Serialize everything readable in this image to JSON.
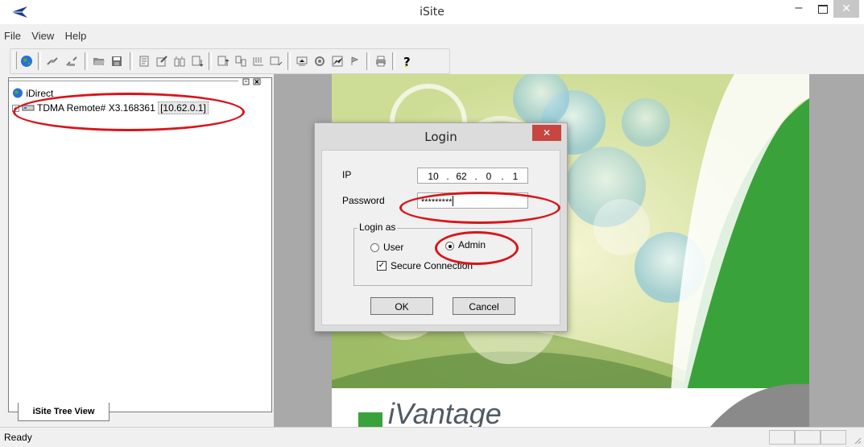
{
  "window": {
    "title": "iSite",
    "controls": {
      "minimize": "–",
      "close": "✕"
    },
    "accent_red": "#d7151b",
    "close_button_color": "#c7463f"
  },
  "menu": {
    "items": [
      "File",
      "View",
      "Help"
    ]
  },
  "toolbar": {
    "icons": [
      "globe-icon",
      "connect-icon",
      "disconnect-icon",
      "open-folder-icon",
      "save-icon",
      "config-icon",
      "edit-icon",
      "compare-icon",
      "download-icon",
      "upload-icon",
      "network-icon",
      "reset-icon",
      "telnet-icon",
      "monitor-icon",
      "print-icon",
      "help-icon"
    ]
  },
  "tree": {
    "root_label": "iDirect",
    "node": {
      "expander": "+",
      "label": "TDMA Remote# X3.168361",
      "ip": "[10.62.0.1]"
    },
    "tab_label": "iSite Tree View"
  },
  "splash": {
    "brand": "iVantage",
    "brand_green": "#3aa23b"
  },
  "dialog": {
    "title": "Login",
    "ip_label": "IP",
    "ip_octets": [
      "10",
      "62",
      "0",
      "1"
    ],
    "password_label": "Password",
    "password_value": "*********",
    "group_label": "Login as",
    "radio_user": "User",
    "radio_admin": "Admin",
    "selected_role": "Admin",
    "secure_label": "Secure Connection",
    "secure_checked": true,
    "ok_label": "OK",
    "cancel_label": "Cancel"
  },
  "status": {
    "text": "Ready"
  }
}
